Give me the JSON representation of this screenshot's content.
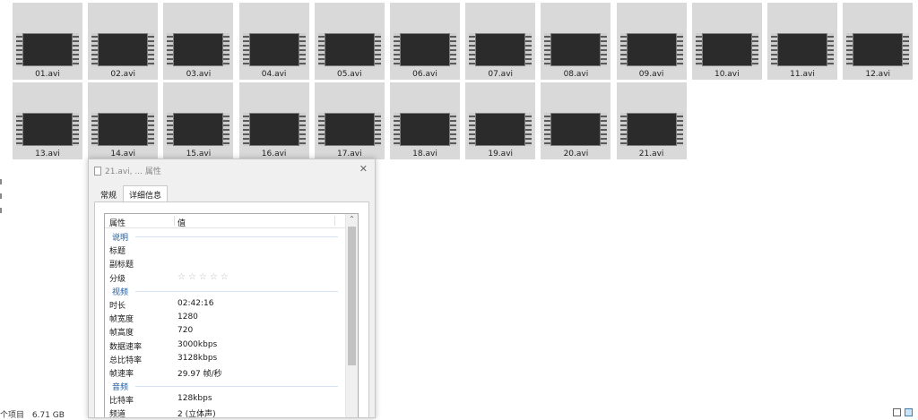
{
  "files": [
    "01.avi",
    "02.avi",
    "03.avi",
    "04.avi",
    "05.avi",
    "06.avi",
    "07.avi",
    "08.avi",
    "09.avi",
    "10.avi",
    "11.avi",
    "12.avi",
    "13.avi",
    "14.avi",
    "15.avi",
    "16.avi",
    "17.avi",
    "18.avi",
    "19.avi",
    "20.avi",
    "21.avi"
  ],
  "status": {
    "items": "个项目",
    "size": "6.71 GB"
  },
  "dialog": {
    "title": "21.avi, ... 属性",
    "close": "✕",
    "tabs": [
      "常规",
      "详细信息"
    ],
    "header": {
      "property": "属性",
      "value": "值"
    },
    "rows": [
      {
        "type": "section",
        "k": "说明"
      },
      {
        "type": "row",
        "k": "标题",
        "v": ""
      },
      {
        "type": "row",
        "k": "副标题",
        "v": ""
      },
      {
        "type": "stars",
        "k": "分级",
        "v": "☆☆☆☆☆"
      },
      {
        "type": "section",
        "k": "视频"
      },
      {
        "type": "row",
        "k": "时长",
        "v": "02:42:16"
      },
      {
        "type": "row",
        "k": "帧宽度",
        "v": "1280"
      },
      {
        "type": "row",
        "k": "帧高度",
        "v": "720"
      },
      {
        "type": "row",
        "k": "数据速率",
        "v": "3000kbps"
      },
      {
        "type": "row",
        "k": "总比特率",
        "v": "3128kbps"
      },
      {
        "type": "row",
        "k": "帧速率",
        "v": "29.97 帧/秒"
      },
      {
        "type": "section",
        "k": "音频"
      },
      {
        "type": "row",
        "k": "比特率",
        "v": "128kbps"
      },
      {
        "type": "row",
        "k": "频道",
        "v": "2 (立体声)"
      }
    ]
  }
}
